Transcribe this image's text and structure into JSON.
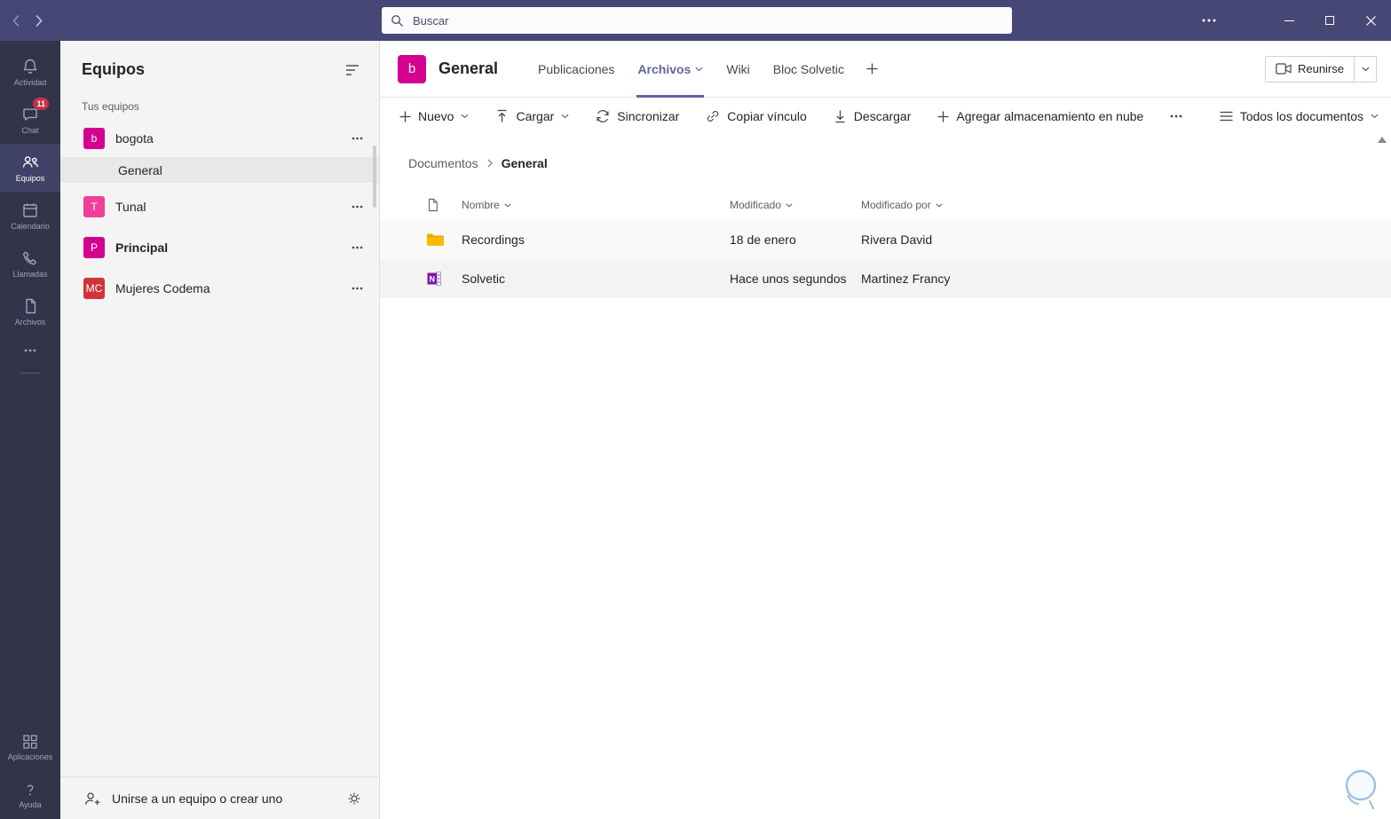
{
  "colors": {
    "accent": "#6264a7",
    "titlebar": "#464775",
    "rail": "#33344a",
    "badge": "#c4314b",
    "folder": "#ffb900",
    "onenote": "#7719aa"
  },
  "titlebar": {
    "search_placeholder": "Buscar"
  },
  "rail": {
    "items": [
      {
        "label": "Actividad"
      },
      {
        "label": "Chat",
        "badge": "11"
      },
      {
        "label": "Equipos",
        "selected": true
      },
      {
        "label": "Calendario"
      },
      {
        "label": "Llamadas"
      },
      {
        "label": "Archivos"
      }
    ],
    "bottom_items": [
      {
        "label": "Aplicaciones"
      },
      {
        "label": "Ayuda"
      }
    ]
  },
  "sidebar": {
    "title": "Equipos",
    "section": "Tus equipos",
    "teams": [
      {
        "name": "bogota",
        "avatar": "b",
        "color": "#d4008f",
        "channels": [
          {
            "name": "General",
            "selected": true
          }
        ]
      },
      {
        "name": "Tunal",
        "avatar": "T",
        "color": "#ef3f9a"
      },
      {
        "name": "Principal",
        "avatar": "P",
        "color": "#d4008f",
        "unread": true
      },
      {
        "name": "Mujeres Codema",
        "avatar": "MC",
        "color": "#d13438"
      }
    ],
    "footer": {
      "join": "Unirse a un equipo o crear uno"
    }
  },
  "channel": {
    "avatar": "b",
    "avatar_color": "#d4008f",
    "title": "General",
    "tabs": [
      {
        "label": "Publicaciones"
      },
      {
        "label": "Archivos",
        "selected": true
      },
      {
        "label": "Wiki"
      },
      {
        "label": "Bloc Solvetic"
      }
    ],
    "meet": "Reunirse"
  },
  "toolbar": {
    "nuevo": "Nuevo",
    "cargar": "Cargar",
    "sincronizar": "Sincronizar",
    "copiar": "Copiar vínculo",
    "descargar": "Descargar",
    "nube": "Agregar almacenamiento en nube",
    "view": "Todos los documentos"
  },
  "breadcrumb": {
    "root": "Documentos",
    "current": "General"
  },
  "files": {
    "columns": {
      "name": "Nombre",
      "modified": "Modificado",
      "modified_by": "Modificado por"
    },
    "rows": [
      {
        "name": "Recordings",
        "type": "folder",
        "modified": "18 de enero",
        "modified_by": "Rivera David"
      },
      {
        "name": "Solvetic",
        "type": "onenote",
        "modified": "Hace unos segundos",
        "modified_by": "Martinez Francy"
      }
    ]
  }
}
